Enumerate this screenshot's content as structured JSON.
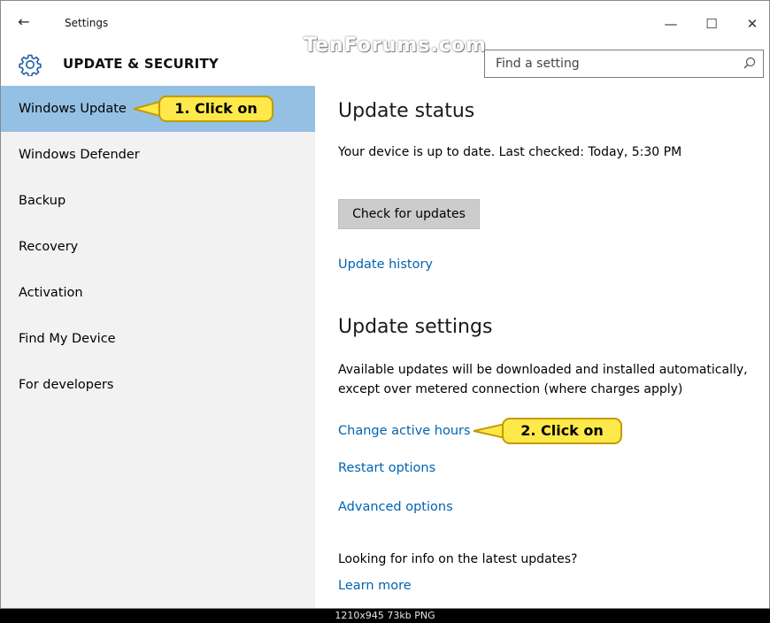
{
  "window": {
    "title": "Settings",
    "controls": {
      "minimize": "—",
      "maximize": "☐",
      "close": "✕"
    },
    "back_icon": "←"
  },
  "header": {
    "section_title": "UPDATE & SECURITY",
    "watermark": "TenForums.com",
    "search": {
      "placeholder": "Find a setting",
      "value": ""
    }
  },
  "sidebar": {
    "items": [
      {
        "label": "Windows Update",
        "active": true
      },
      {
        "label": "Windows Defender"
      },
      {
        "label": "Backup"
      },
      {
        "label": "Recovery"
      },
      {
        "label": "Activation"
      },
      {
        "label": "Find My Device"
      },
      {
        "label": "For developers"
      }
    ]
  },
  "main": {
    "update_status_heading": "Update status",
    "status_text": "Your device is up to date. Last checked: Today, 5:30 PM",
    "check_button": "Check for updates",
    "update_history_link": "Update history",
    "update_settings_heading": "Update settings",
    "settings_text": "Available updates will be downloaded and installed automatically, except over metered connection (where charges apply)",
    "change_hours_link": "Change active hours",
    "restart_options_link": "Restart options",
    "advanced_options_link": "Advanced options",
    "info_text": "Looking for info on the latest updates?",
    "learn_more_link": "Learn more"
  },
  "callouts": {
    "first": "1. Click on",
    "second": "2. Click on"
  },
  "footer": {
    "image_info": "1210x945  73kb  PNG"
  },
  "colors": {
    "accent_link": "#0063b1",
    "sidebar_active": "#94c0e4",
    "sidebar_bg": "#f2f2f2",
    "callout_fill": "#ffe94a",
    "callout_border": "#c59a00"
  }
}
